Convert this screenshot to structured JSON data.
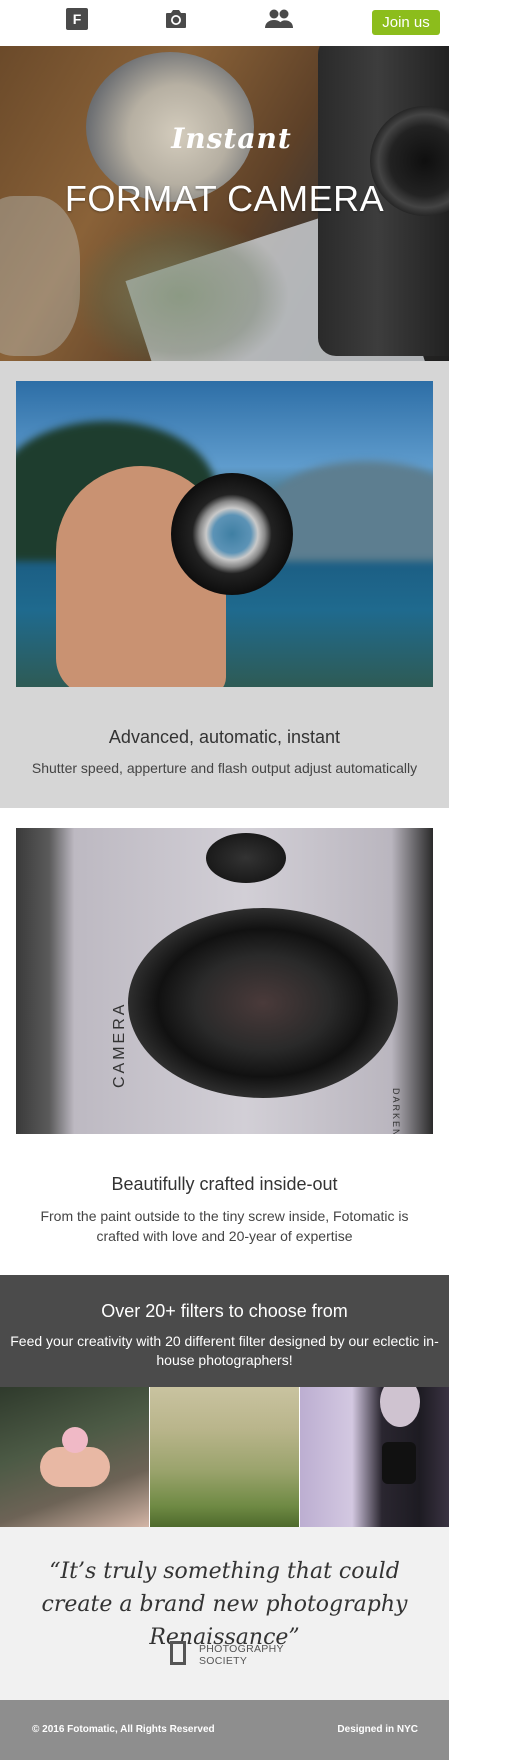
{
  "nav": {
    "logo_letter": "F",
    "camera_icon": "camera-icon",
    "people_icon": "people-icon",
    "join_label": "Join us",
    "accent": "#8cbd1c"
  },
  "hero": {
    "tagline": "Instant",
    "title": "FORMAT CAMERA"
  },
  "features": [
    {
      "title": "Advanced, automatic, instant",
      "description": "Shutter speed, apperture and flash output adjust automatically"
    },
    {
      "title": "Beautifully crafted inside-out",
      "description": "From the paint outside to the tiny screw inside, Fotomatic is crafted with love and 20-year of expertise",
      "camera_label": "CAMERA",
      "camera_small_label": "DARKEN"
    }
  ],
  "filters": {
    "title": "Over 20+ filters to choose from",
    "description": "Feed your creativity with 20 different filter designed by our eclectic in-house photographers!"
  },
  "quote": {
    "text": "“It’s truly something that could create a brand new photography Renaissance”",
    "source_line1": "PHOTOGRAPHY",
    "source_line2": "SOCIETY"
  },
  "footer": {
    "copyright": "© 2016 Fotomatic, All Rights Reserved",
    "designed": "Designed in NYC"
  }
}
